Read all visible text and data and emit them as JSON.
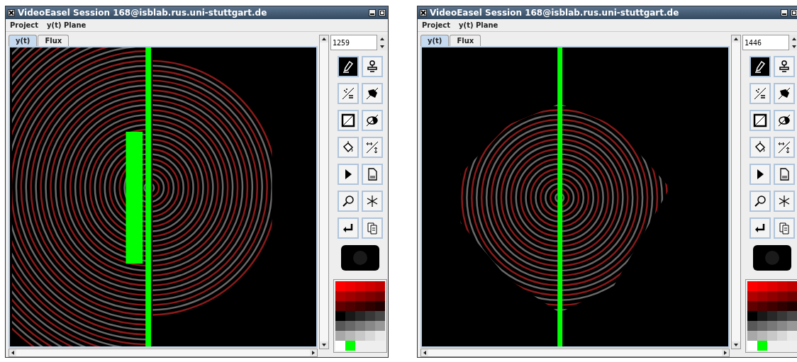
{
  "windows": [
    {
      "title": "VideoEasel Session 168@isblab.rus.uni-stuttgart.de",
      "menu": [
        "Project",
        "y(t) Plane"
      ],
      "tabs": [
        {
          "label": "y(t)",
          "selected": true
        },
        {
          "label": "Flux",
          "selected": false
        }
      ],
      "frame": "1259",
      "view": {
        "kind": "barrier"
      },
      "tools": [
        {
          "kind": "pencil",
          "selected": true
        },
        {
          "kind": "stamp",
          "selected": false
        },
        {
          "kind": "spray",
          "selected": false
        },
        {
          "kind": "fill",
          "selected": false
        },
        {
          "kind": "rect",
          "selected": false
        },
        {
          "kind": "ellipse",
          "selected": false
        },
        {
          "kind": "bucket",
          "selected": false
        },
        {
          "kind": "resize",
          "selected": false
        },
        {
          "kind": "play",
          "selected": false
        },
        {
          "kind": "clear",
          "selected": false
        },
        {
          "kind": "zoom",
          "selected": false
        },
        {
          "kind": "freeze",
          "selected": false
        },
        {
          "kind": "undo",
          "selected": false
        },
        {
          "kind": "copy",
          "selected": false
        }
      ],
      "palette": [
        {
          "color": "#ff0000"
        },
        {
          "color": "#f00000"
        },
        {
          "color": "#e00000"
        },
        {
          "color": "#d00000"
        },
        {
          "color": "#c00000"
        },
        {
          "color": "#b00000"
        },
        {
          "color": "#a00000"
        },
        {
          "color": "#900000"
        },
        {
          "color": "#800000"
        },
        {
          "color": "#700000"
        },
        {
          "color": "#600000"
        },
        {
          "color": "#500000"
        },
        {
          "color": "#400000"
        },
        {
          "color": "#300000"
        },
        {
          "color": "#200000"
        },
        {
          "color": "#000000"
        },
        {
          "color": "#181818"
        },
        {
          "color": "#282828"
        },
        {
          "color": "#383838"
        },
        {
          "color": "#484848"
        },
        {
          "color": "#585858"
        },
        {
          "color": "#686868"
        },
        {
          "color": "#787878"
        },
        {
          "color": "#888888"
        },
        {
          "color": "#989898"
        },
        {
          "color": "#a8a8a8"
        },
        {
          "color": "#b8b8b8"
        },
        {
          "color": "#c8c8c8"
        },
        {
          "color": "#d8d8d8"
        },
        {
          "color": "#e8e8e8"
        },
        {
          "color": "#ffffff"
        },
        {
          "color": "#00ff00"
        }
      ]
    },
    {
      "title": "VideoEasel Session 168@isblab.rus.uni-stuttgart.de",
      "menu": [
        "Project",
        "y(t) Plane"
      ],
      "tabs": [
        {
          "label": "y(t)",
          "selected": true
        },
        {
          "label": "Flux",
          "selected": false
        }
      ],
      "frame": "1446",
      "view": {
        "kind": "double_slit"
      },
      "tools": [
        {
          "kind": "pencil",
          "selected": true
        },
        {
          "kind": "stamp",
          "selected": false
        },
        {
          "kind": "spray",
          "selected": false
        },
        {
          "kind": "fill",
          "selected": false
        },
        {
          "kind": "rect",
          "selected": false
        },
        {
          "kind": "ellipse",
          "selected": false
        },
        {
          "kind": "bucket",
          "selected": false
        },
        {
          "kind": "resize",
          "selected": false
        },
        {
          "kind": "play",
          "selected": false
        },
        {
          "kind": "clear",
          "selected": false
        },
        {
          "kind": "zoom",
          "selected": false
        },
        {
          "kind": "freeze",
          "selected": false
        },
        {
          "kind": "undo",
          "selected": false
        },
        {
          "kind": "copy",
          "selected": false
        }
      ],
      "palette": [
        {
          "color": "#ff0000"
        },
        {
          "color": "#f00000"
        },
        {
          "color": "#e00000"
        },
        {
          "color": "#d00000"
        },
        {
          "color": "#c00000"
        },
        {
          "color": "#b00000"
        },
        {
          "color": "#a00000"
        },
        {
          "color": "#900000"
        },
        {
          "color": "#800000"
        },
        {
          "color": "#700000"
        },
        {
          "color": "#600000"
        },
        {
          "color": "#500000"
        },
        {
          "color": "#400000"
        },
        {
          "color": "#300000"
        },
        {
          "color": "#200000"
        },
        {
          "color": "#000000"
        },
        {
          "color": "#181818"
        },
        {
          "color": "#282828"
        },
        {
          "color": "#383838"
        },
        {
          "color": "#484848"
        },
        {
          "color": "#585858"
        },
        {
          "color": "#686868"
        },
        {
          "color": "#787878"
        },
        {
          "color": "#888888"
        },
        {
          "color": "#989898"
        },
        {
          "color": "#a8a8a8"
        },
        {
          "color": "#b8b8b8"
        },
        {
          "color": "#c8c8c8"
        },
        {
          "color": "#d8d8d8"
        },
        {
          "color": "#e8e8e8"
        },
        {
          "color": "#ffffff"
        },
        {
          "color": "#00ff00"
        }
      ]
    }
  ]
}
